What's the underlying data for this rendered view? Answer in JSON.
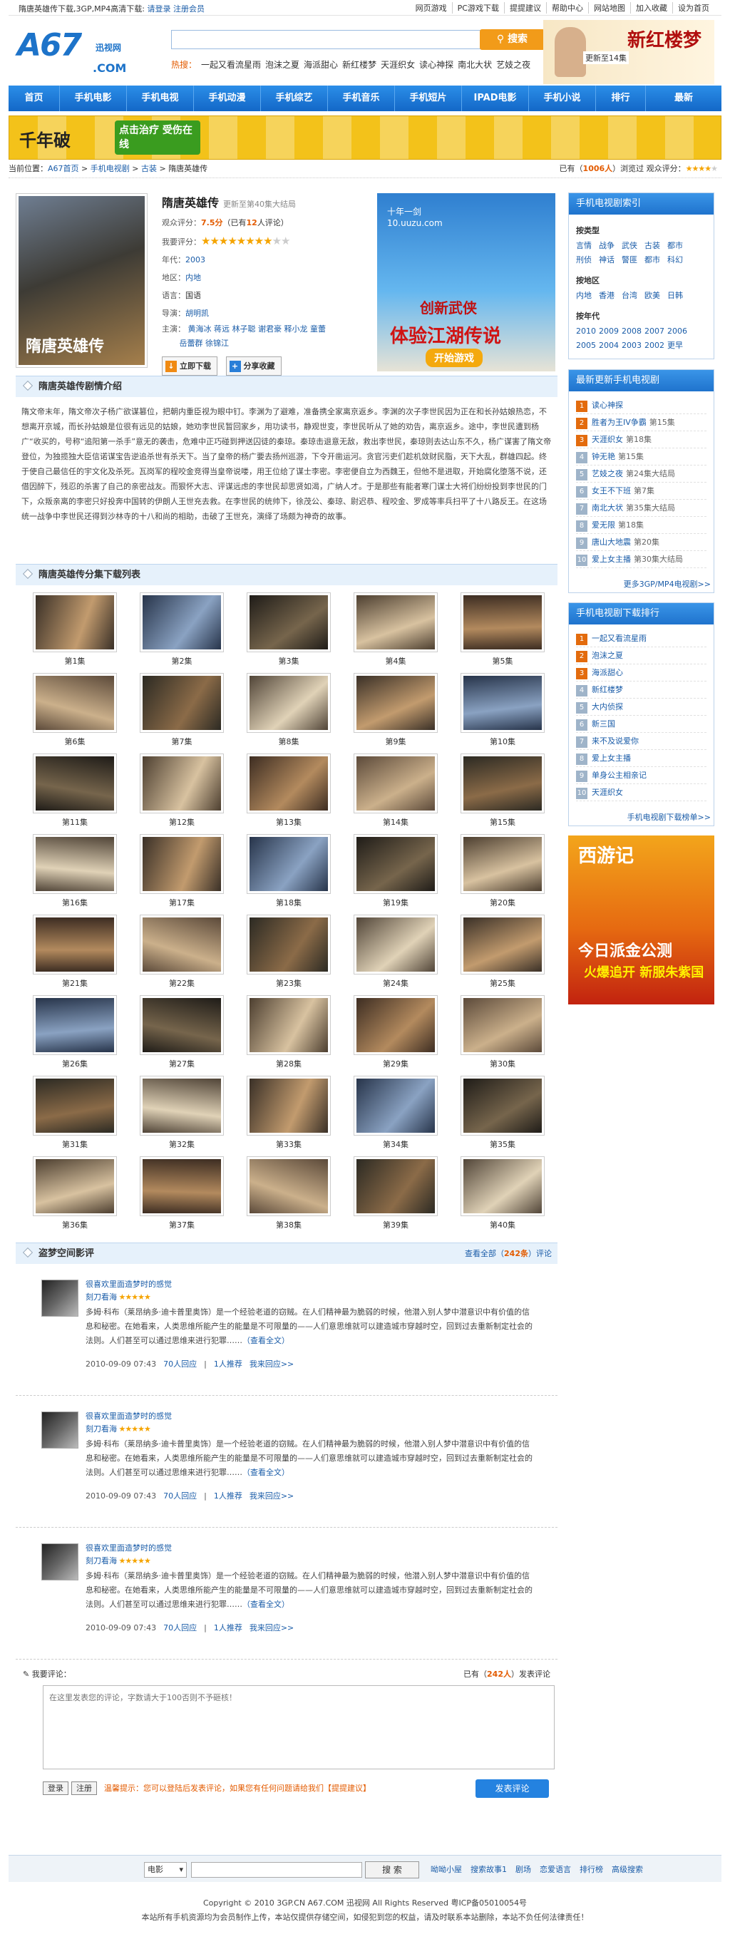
{
  "topbar": {
    "left": "隋唐英雄传下载,3GP,MP4高清下载:",
    "login": "请登录",
    "register": "注册会员",
    "links": [
      "网页游戏",
      "PC游戏下载",
      "提提建议",
      "帮助中心",
      "网站地图",
      "加入收藏",
      "设为首页"
    ]
  },
  "logo": {
    "brand": "A67",
    "sub": "迅视网",
    "com": ".COM"
  },
  "search": {
    "placeholder": "",
    "button": "搜索",
    "hot_label": "热搜：",
    "hot": [
      "一起又看流星雨",
      "泡沫之夏",
      "海派甜心",
      "新红楼梦",
      "天涯织女",
      "读心神探",
      "南北大状",
      "艺妓之夜"
    ]
  },
  "banner_tr": {
    "title": "新红楼梦",
    "sub": "更新至14集"
  },
  "nav": [
    "首页",
    "手机电影",
    "手机电视",
    "手机动漫",
    "手机综艺",
    "手机音乐",
    "手机短片",
    "IPAD电影",
    "手机小说",
    "排行",
    "最新"
  ],
  "adband": {
    "t1": "千年破",
    "t2": "点击治疗 受伤在线"
  },
  "crumb": {
    "label": "当前位置：",
    "path": [
      "A67首页",
      "手机电视剧",
      "古装",
      "隋唐英雄传"
    ],
    "right_pre": "已有（",
    "count": "1006人",
    "right_mid": "）浏览过",
    "score_label": "观众评分："
  },
  "movie": {
    "title": "隋唐英雄传",
    "update": "更新至第40集大结局",
    "poster_text": "隋唐英雄传",
    "score_label": "观众评分：",
    "score": "7.5分",
    "score_note_pre": "（已有",
    "score_votes": "12",
    "score_note_post": "人评论）",
    "rate_label": "我要评分：",
    "year_label": "年代：",
    "year": "2003",
    "region_label": "地区：",
    "region": "内地",
    "lang_label": "语言：",
    "lang": "国语",
    "director_label": "导演：",
    "director": "胡明凯",
    "cast_label": "主演：",
    "cast": [
      "黄海冰",
      "蒋远",
      "林子聪",
      "谢君豪",
      "释小龙",
      "童蕾",
      "岳蕾群",
      "徐锦江"
    ],
    "btn_download": "立即下载",
    "btn_share": "分享收藏"
  },
  "ad_square": {
    "brand": "十年一剑",
    "url": "10.uuzu.com",
    "t1": "创新武侠",
    "t2": "体验江湖传说",
    "btn": "开始游戏"
  },
  "synopsis": {
    "heading": "隋唐英雄传剧情介绍",
    "text": "隋文帝末年，隋文帝次子杨广欲谋篡位，把朝内重臣视为眼中钉。李渊为了避难，准备携全家离京返乡。李渊的次子李世民因为正在和长孙姑娘热恋，不想离开京城，而长孙姑娘是位很有远见的姑娘，她劝李世民暂回家乡，用功读书，静观世变，李世民听从了她的劝告，离京返乡。途中，李世民遭到杨广“收买的，号称“追阳第一杀手”意无的袭击，危难中正巧碰到押送囚徒的秦琼。秦琼击退意无敌，救出李世民，秦琼则去达山东不久，杨广谋害了隋文帝登位，为独揽独大臣信诺谋宝告逆追杀世有杀天下。当了皇帝的杨广要去扬州巡游，下令开凿运河。贪官污吏们趁机敛财民脂，天下大乱，群雄四起。终于使自己最信任的宇文化及杀死。瓦岗军的程咬金竞得当皇帝说喽，用王位给了谋士李密。李密便自立为西魏王，但他不是进取，开始腐化堕落不说，还借因醉下，残忍的杀害了自己的亲密战友。而狠怀大志、评谋远虑的李世民却思贤如渴，广纳人才。于是那些有能者寒门谋士大将们纷纷投到李世民的门下，众叛亲离的李密只好投奔中国转的伊朗人王世充去救。在李世民的统帅下，徐茂公、秦琼、尉迟恭、程咬金、罗成等率兵扫平了十八路反王。在这场统一战争中李世民还得到沙林寺的十八和尚的相助，击破了王世充，演绎了场颇为神奇的故事。"
  },
  "episodes": {
    "heading": "隋唐英雄传分集下载列表",
    "items": [
      "第1集",
      "第2集",
      "第3集",
      "第4集",
      "第5集",
      "第6集",
      "第7集",
      "第8集",
      "第9集",
      "第10集",
      "第11集",
      "第12集",
      "第13集",
      "第14集",
      "第15集",
      "第16集",
      "第17集",
      "第18集",
      "第19集",
      "第20集",
      "第21集",
      "第22集",
      "第23集",
      "第24集",
      "第25集",
      "第26集",
      "第27集",
      "第28集",
      "第29集",
      "第30集",
      "第31集",
      "第32集",
      "第33集",
      "第34集",
      "第35集",
      "第36集",
      "第37集",
      "第38集",
      "第39集",
      "第40集"
    ]
  },
  "reviews": {
    "heading": "盗梦空间影评",
    "all_pre": "查看全部（",
    "all_count": "242条",
    "all_post": "）评论",
    "items": [
      {
        "title": "很喜欢里面造梦时的感觉",
        "user": "刻刀看海",
        "text": "多姆·科布（莱昂纳多·迪卡普里奥饰）是一个经验老道的窃贼。在人们精神最为脆弱的时候，他潜入别人梦中潜意识中有价值的信息和秘密。在她看来，人类思维所能产生的能量是不可限量的——人们意思维就可以建造城市穿越时空，回到过去重新制定社会的法则。人们甚至可以通过思维来进行犯罪……",
        "more": "（查看全文）",
        "date": "2010-09-09 07:43",
        "reply": "70人回应",
        "rec": "1人推荐",
        "me": "我来回应>>"
      },
      {
        "title": "很喜欢里面造梦时的感觉",
        "user": "刻刀看海",
        "text": "多姆·科布（莱昂纳多·迪卡普里奥饰）是一个经验老道的窃贼。在人们精神最为脆弱的时候，他潜入别人梦中潜意识中有价值的信息和秘密。在她看来，人类思维所能产生的能量是不可限量的——人们意思维就可以建造城市穿越时空，回到过去重新制定社会的法则。人们甚至可以通过思维来进行犯罪……",
        "more": "（查看全文）",
        "date": "2010-09-09 07:43",
        "reply": "70人回应",
        "rec": "1人推荐",
        "me": "我来回应>>"
      },
      {
        "title": "很喜欢里面造梦时的感觉",
        "user": "刻刀看海",
        "text": "多姆·科布（莱昂纳多·迪卡普里奥饰）是一个经验老道的窃贼。在人们精神最为脆弱的时候，他潜入别人梦中潜意识中有价值的信息和秘密。在她看来，人类思维所能产生的能量是不可限量的——人们意思维就可以建造城市穿越时空，回到过去重新制定社会的法则。人们甚至可以通过思维来进行犯罪……",
        "more": "（查看全文）",
        "date": "2010-09-09 07:43",
        "reply": "70人回应",
        "rec": "1人推荐",
        "me": "我来回应>>"
      }
    ]
  },
  "comment_form": {
    "label": "我要评论：",
    "right_pre": "已有（",
    "right_count": "242人",
    "right_post": "）发表评论",
    "placeholder": "在这里发表您的评论，字数请大于100否则不予砸核！",
    "btn_login": "登录",
    "btn_register": "注册",
    "tip": "温馨提示：您可以登陆后发表评论，如果您有任何问题请给我们【提提建议】",
    "btn_send": "发表评论"
  },
  "side_index": {
    "heading": "手机电视剧索引",
    "type_label": "按类型",
    "types": [
      "言情",
      "战争",
      "武侠",
      "古装",
      "都市",
      "刑侦",
      "神话",
      "警匪",
      "都市",
      "科幻"
    ],
    "region_label": "按地区",
    "regions": [
      "内地",
      "香港",
      "台湾",
      "欧美",
      "日韩"
    ],
    "year_label": "按年代",
    "years": [
      "2010",
      "2009",
      "2008",
      "2007",
      "2006",
      "2005",
      "2004",
      "2003",
      "2002",
      "更早"
    ]
  },
  "side_latest": {
    "heading": "最新更新手机电视剧",
    "items": [
      {
        "t": "读心神探",
        "n": ""
      },
      {
        "t": "胜者为王IV争霸",
        "n": "第15集"
      },
      {
        "t": "天涯织女",
        "n": "第18集"
      },
      {
        "t": "钟无艳",
        "n": "第15集"
      },
      {
        "t": "艺妓之夜",
        "n": "第24集大结局"
      },
      {
        "t": "女王不下班",
        "n": "第7集"
      },
      {
        "t": "南北大状",
        "n": "第35集大结局"
      },
      {
        "t": "爱无限",
        "n": "第18集"
      },
      {
        "t": "唐山大地震",
        "n": "第20集"
      },
      {
        "t": "爱上女主播",
        "n": "第30集大结局"
      }
    ],
    "more": "更多3GP/MP4电视剧>>"
  },
  "side_rank": {
    "heading": "手机电视剧下载排行",
    "items": [
      "一起又看流星雨",
      "泡沫之夏",
      "海派甜心",
      "新红楼梦",
      "大内侦探",
      "新三国",
      "来不及说爱你",
      "爱上女主播",
      "单身公主相亲记",
      "天涯织女"
    ],
    "more": "手机电视剧下载榜单>>"
  },
  "side_ad": {
    "t1": "西游记",
    "t2": "今日派金公测",
    "t3": "火爆追开 新服朱紫国"
  },
  "footer": {
    "select": "电影",
    "search_btn": "搜 索",
    "links": [
      "呦呦小屋",
      "搜索故事1",
      "剧场",
      "恋爱语言",
      "排行榜",
      "高级搜索"
    ],
    "copy1": "Copyright © 2010 3GP.CN A67.COM 迅视网 All Rights Reserved 粤ICP备05010054号",
    "copy2": "本站所有手机资源均为会员制作上传，本站仅提供存储空间，如侵犯到您的权益，请及时联系本站删除，本站不负任何法律责任！"
  }
}
